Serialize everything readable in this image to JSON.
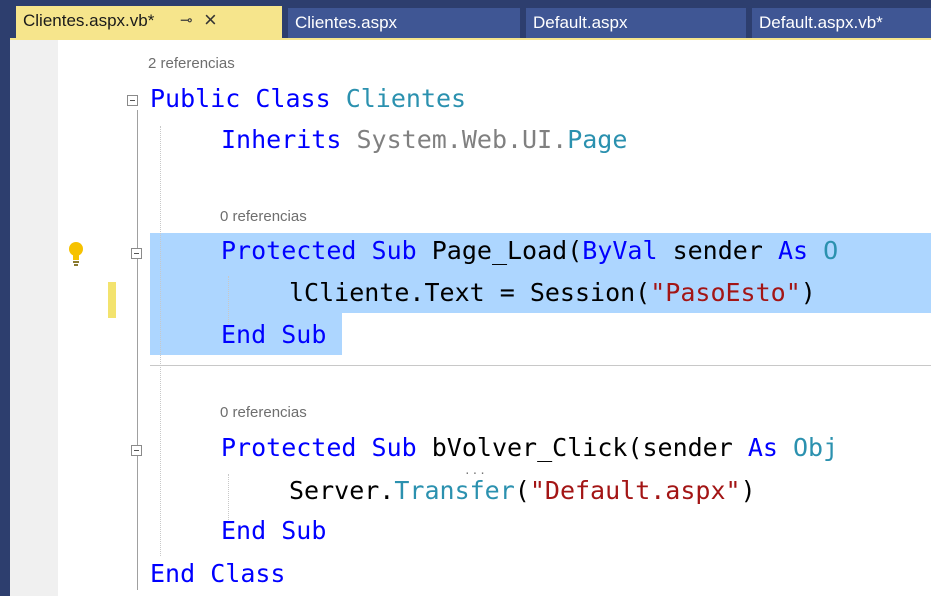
{
  "tabs": [
    {
      "label": "Clientes.aspx.vb*",
      "active": true,
      "pin_icon": "pin-icon",
      "close_icon": "close-icon"
    },
    {
      "label": "Clientes.aspx"
    },
    {
      "label": "Default.aspx"
    },
    {
      "label": "Default.aspx.vb*"
    }
  ],
  "editor": {
    "refs": {
      "class_refs": "2 referencias",
      "page_load_refs": "0 referencias",
      "bvolver_refs": "0 referencias"
    },
    "lines": {
      "l1": {
        "kw1": "Public",
        "kw2": "Class",
        "name": "Clientes"
      },
      "l2": {
        "kw": "Inherits",
        "ns": "System.Web.UI.",
        "type": "Page"
      },
      "l3": {
        "kw1": "Protected",
        "kw2": "Sub",
        "name": "Page_Load(",
        "kw3": "ByVal",
        "p": " sender ",
        "kw4": "As",
        "rest": " O"
      },
      "l4": {
        "a": "lCliente.Text = Session(",
        "str": "\"PasoEsto\"",
        "b": ")"
      },
      "l5": {
        "kw1": "End",
        "kw2": "Sub"
      },
      "l6": {
        "kw1": "Protected",
        "kw2": "Sub",
        "name": "bVolver_Click(sender ",
        "kw3": "As",
        "rest": " Obj"
      },
      "l7": {
        "a": "Server.",
        "method": "Transfer",
        "b": "(",
        "str": "\"Default.aspx\"",
        "c": ")"
      },
      "l8": {
        "kw1": "End",
        "kw2": "Sub"
      },
      "l9": {
        "kw1": "End",
        "kw2": "Class"
      }
    }
  },
  "colors": {
    "keyword": "#0000ff",
    "type": "#2b91af",
    "string": "#a31515",
    "selection": "#add6ff",
    "active_tab": "#f6e58c",
    "tab_bar": "#2d3e6e"
  },
  "icons": [
    "pin-icon",
    "close-icon",
    "lightbulb-icon",
    "collapse-icon"
  ]
}
